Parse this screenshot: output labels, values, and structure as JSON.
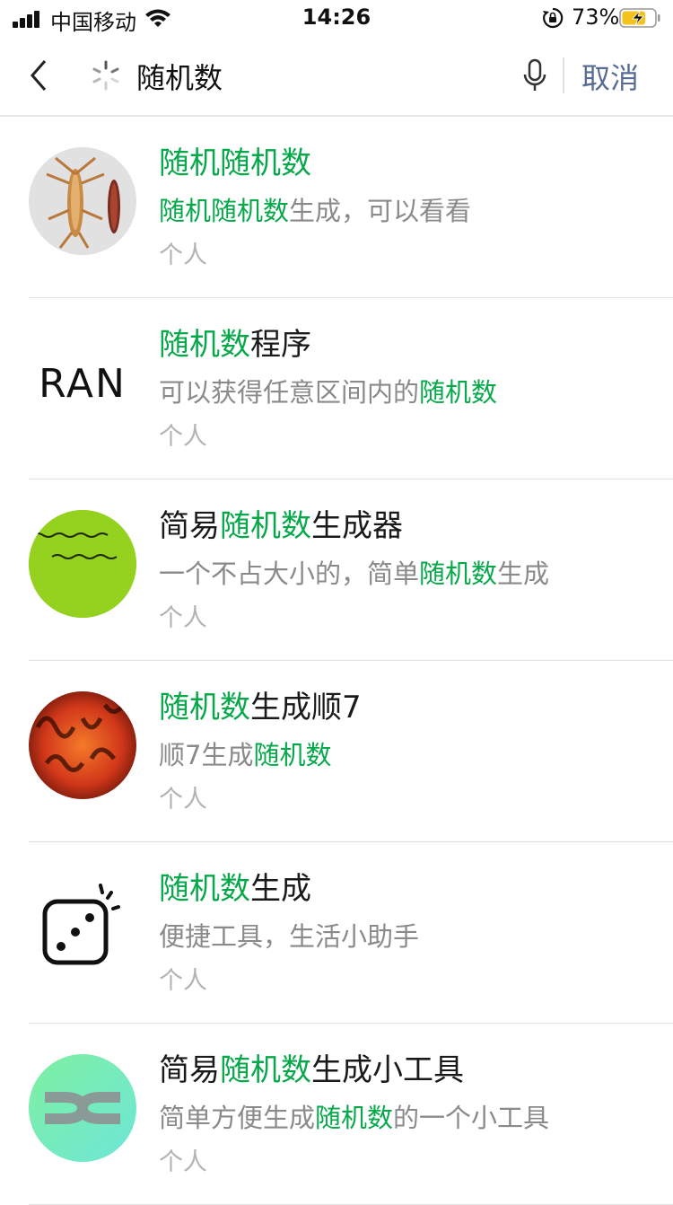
{
  "status_bar": {
    "carrier": "中国移动",
    "time": "14:26",
    "battery_percent": "73%",
    "battery_level": 0.73,
    "charging": true
  },
  "search": {
    "query": "随机数",
    "cancel_label": "取消"
  },
  "colors": {
    "highlight": "#07a84a",
    "cancel": "#576b95",
    "description": "#8a8a8a",
    "type": "#b3b3b3"
  },
  "results": [
    {
      "title": [
        {
          "t": "随机随机数",
          "hl": true
        }
      ],
      "desc": [
        {
          "t": "随机随机数",
          "hl": true
        },
        {
          "t": "生成，可以看看",
          "hl": false
        }
      ],
      "type": "个人",
      "icon": "shrimp-photo-avatar"
    },
    {
      "title": [
        {
          "t": "随机数",
          "hl": true
        },
        {
          "t": "程序",
          "hl": false
        }
      ],
      "desc": [
        {
          "t": "可以获得任意区间内的",
          "hl": false
        },
        {
          "t": "随机数",
          "hl": true
        }
      ],
      "type": "个人",
      "icon": "ran-text-avatar",
      "avatar_text": "RAN"
    },
    {
      "title": [
        {
          "t": "简易",
          "hl": false
        },
        {
          "t": "随机数",
          "hl": true
        },
        {
          "t": "生成器",
          "hl": false
        }
      ],
      "desc": [
        {
          "t": "一个不占大小的，简单",
          "hl": false
        },
        {
          "t": "随机数",
          "hl": true
        },
        {
          "t": "生成",
          "hl": false
        }
      ],
      "type": "个人",
      "icon": "green-calligraphy-avatar"
    },
    {
      "title": [
        {
          "t": "随机数",
          "hl": true
        },
        {
          "t": "生成顺7",
          "hl": false
        }
      ],
      "desc": [
        {
          "t": "顺7生成",
          "hl": false
        },
        {
          "t": "随机数",
          "hl": true
        }
      ],
      "type": "个人",
      "icon": "orange-numbers-avatar"
    },
    {
      "title": [
        {
          "t": "随机数",
          "hl": true
        },
        {
          "t": "生成",
          "hl": false
        }
      ],
      "desc": [
        {
          "t": "便捷工具，生活小助手",
          "hl": false
        }
      ],
      "type": "个人",
      "icon": "dice-avatar"
    },
    {
      "title": [
        {
          "t": "简易",
          "hl": false
        },
        {
          "t": "随机数",
          "hl": true
        },
        {
          "t": "生成小工具",
          "hl": false
        }
      ],
      "desc": [
        {
          "t": "简单方便生成",
          "hl": false
        },
        {
          "t": "随机数",
          "hl": true
        },
        {
          "t": "的一个小工具",
          "hl": false
        }
      ],
      "type": "个人",
      "icon": "shuffle-avatar"
    }
  ]
}
